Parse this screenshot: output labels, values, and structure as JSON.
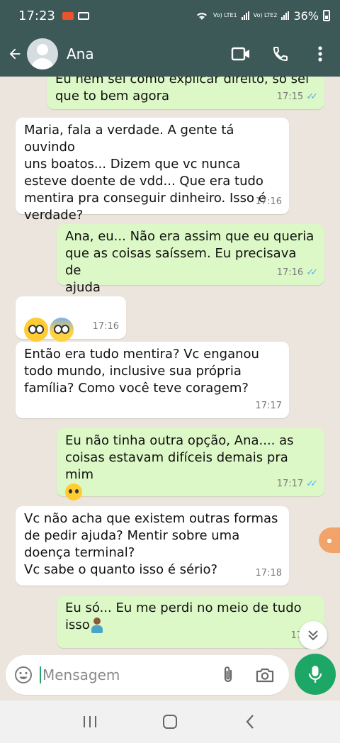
{
  "status_bar": {
    "time": "17:23",
    "sim1_label": "Vo) LTE1",
    "sim2_label": "Vo) LTE2",
    "battery": "36%"
  },
  "header": {
    "contact_name": "Ana"
  },
  "messages": [
    {
      "direction": "out",
      "text": "Eu nem sei como explicar direito, só sei\nque to bem agora",
      "time": "17:15",
      "read": true
    },
    {
      "direction": "in",
      "text": "Maria, fala a verdade. A gente tá ouvindo\nuns boatos... Dizem que vc nunca\nesteve doente de vdd... Que era tudo\nmentira pra conseguir dinheiro. Isso é\nverdade?",
      "time": "17:16"
    },
    {
      "direction": "out",
      "text": "Ana, eu... Não era assim que eu queria\nque as coisas saíssem. Eu precisava de\najuda",
      "time": "17:16",
      "read": true
    },
    {
      "direction": "in",
      "emojis": [
        "flushed-face-emoji",
        "face-screaming-in-fear-emoji"
      ],
      "time": "17:16"
    },
    {
      "direction": "in",
      "text": "Então era tudo mentira? Vc enganou\ntodo mundo, inclusive sua própria\nfamília? Como você teve coragem?",
      "time": "17:17"
    },
    {
      "direction": "out",
      "text": "Eu não tinha outra opção, Ana.... as\ncoisas estavam difíceis demais pra mim",
      "emoji": "pleading-face-emoji",
      "time": "17:17",
      "read": true
    },
    {
      "direction": "in",
      "text": "Vc não acha que existem outras formas\nde pedir ajuda? Mentir sobre uma\ndoença terminal?\nVc sabe o quanto isso é sério?",
      "time": "17:18"
    },
    {
      "direction": "out",
      "text": "Eu só... Eu me perdi no meio de tudo\nisso",
      "emoji": "person-shrugging-emoji",
      "time": "17:18"
    }
  ],
  "input": {
    "placeholder": "Mensagem"
  },
  "colors": {
    "header": "#3d5957",
    "chat_background": "#ece5dd",
    "outgoing_bubble": "#dcf8c6",
    "incoming_bubble": "#ffffff",
    "read_ticks": "#4fb3f6",
    "mic_button": "#1ca767"
  },
  "icons": {
    "back": "arrow-left-icon",
    "video": "video-camera-icon",
    "call": "phone-icon",
    "menu": "more-vertical-icon",
    "emoji": "emoji-icon",
    "attach": "paperclip-icon",
    "camera": "camera-icon",
    "mic": "microphone-icon",
    "scroll": "double-chevron-down-icon"
  }
}
